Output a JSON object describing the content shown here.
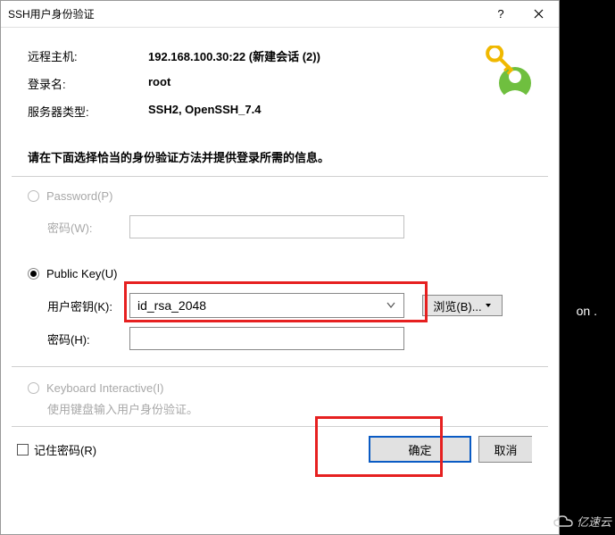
{
  "titlebar": {
    "title": "SSH用户身份验证"
  },
  "info": {
    "host_label": "远程主机:",
    "host_value": "192.168.100.30:22 (新建会话 (2))",
    "login_label": "登录名:",
    "login_value": "root",
    "server_label": "服务器类型:",
    "server_value": "SSH2, OpenSSH_7.4"
  },
  "instruction": "请在下面选择恰当的身份验证方法并提供登录所需的信息。",
  "password_section": {
    "radio_label": "Password(P)",
    "field_label": "密码(W):"
  },
  "publickey_section": {
    "radio_label": "Public Key(U)",
    "key_label": "用户密钥(K):",
    "key_value": "id_rsa_2048",
    "browse_label": "浏览(B)...",
    "pw_label": "密码(H):"
  },
  "ki_section": {
    "radio_label": "Keyboard Interactive(I)",
    "sub_text": "使用键盘输入用户身份验证。"
  },
  "bottom": {
    "remember_label": "记住密码(R)",
    "ok_label": "确定",
    "cancel_label": "取消"
  },
  "watermark": "亿速云",
  "bg_text": "on ."
}
